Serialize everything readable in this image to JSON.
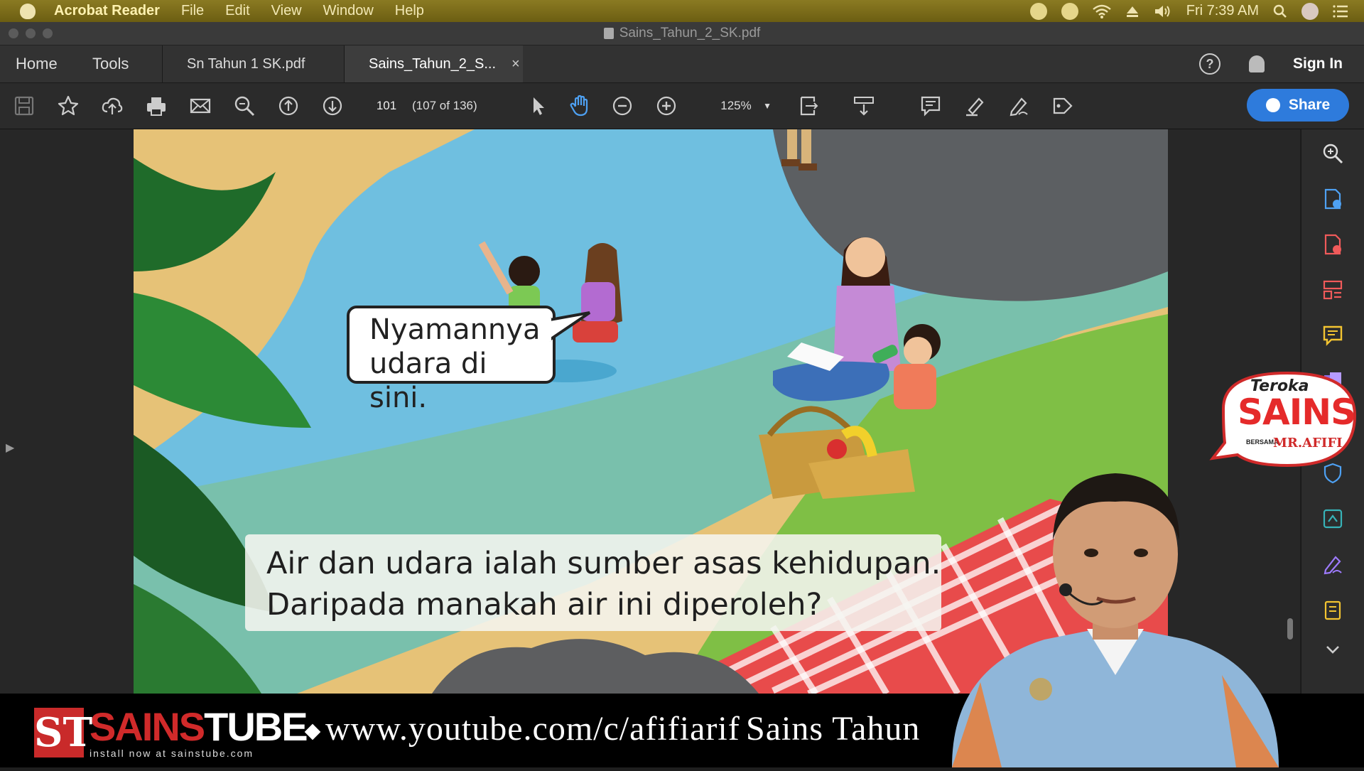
{
  "menubar": {
    "app": "Acrobat Reader",
    "items": [
      "File",
      "Edit",
      "View",
      "Window",
      "Help"
    ],
    "clock": "Fri 7:39 AM"
  },
  "window": {
    "title": "Sains_Tahun_2_SK.pdf"
  },
  "tabs": {
    "home": "Home",
    "tools": "Tools",
    "doc1": "Sn Tahun 1 SK.pdf",
    "doc2": "Sains_Tahun_2_S...",
    "close": "×",
    "help": "?",
    "signin": "Sign In"
  },
  "toolbar": {
    "page_number": "101",
    "page_of": "(107 of 136)",
    "zoom": "125%",
    "share": "Share"
  },
  "document": {
    "speech_bubble": [
      "Nyamannya",
      "udara di sini."
    ],
    "caption": [
      "Air dan udara ialah sumber asas kehidupan.",
      "Daripada manakah air ini diperoleh?"
    ]
  },
  "badge": {
    "line1": "Teroka",
    "line2": "SAINS",
    "line3": "BERSAMA",
    "line4": "MR.AFIFI"
  },
  "footer": {
    "logo_letters": "ST",
    "brand_a": "SAINS",
    "brand_b": "TUBE",
    "tagline": "install now at sainstube.com",
    "url": "www.youtube.com/c/afifiarif",
    "ticker": "Sains Tahun"
  },
  "colors": {
    "menubar": "#7d6e1a",
    "share_button": "#2e7bdc",
    "brand_red": "#d02a2a",
    "water": "#6fbfe0",
    "sand": "#e6c277"
  }
}
